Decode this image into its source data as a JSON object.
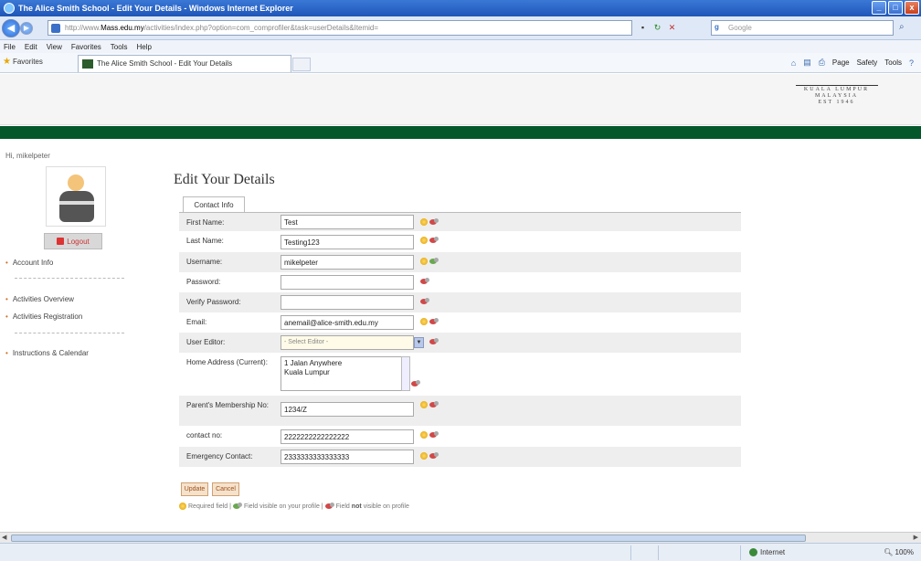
{
  "window": {
    "title": "The Alice Smith School - Edit Your Details - Windows Internet Explorer",
    "minimize": "_",
    "maximize": "□",
    "close": "x"
  },
  "address": {
    "host": "Mass.edu.my",
    "url_prefix": "http://www.",
    "url_rest": "/activities/index.php?option=com_comprofiler&task=userDetails&Itemid=",
    "search_placeholder": "Google"
  },
  "menu": [
    "File",
    "Edit",
    "View",
    "Favorites",
    "Tools",
    "Help"
  ],
  "favorites_label": "Favorites",
  "tab_title": "The Alice Smith School - Edit Your Details",
  "command_bar": [
    "Page",
    "Safety",
    "Tools"
  ],
  "logo": {
    "line1": "KUALA LUMPUR",
    "line2": "MALAYSIA",
    "line3": "EST 1946"
  },
  "sidebar": {
    "greeting": "Hi, mikelpeter",
    "logout": "Logout",
    "links": [
      "Account Info",
      "Activities Overview",
      "Activities Registration",
      "Instructions & Calendar"
    ]
  },
  "page": {
    "title": "Edit Your Details",
    "tab": "Contact Info"
  },
  "form": {
    "first_name": {
      "label": "First Name:",
      "value": "Test"
    },
    "last_name": {
      "label": "Last Name:",
      "value": "Testing123"
    },
    "username": {
      "label": "Username:",
      "value": "mikelpeter"
    },
    "password": {
      "label": "Password:",
      "value": ""
    },
    "verify_password": {
      "label": "Verify Password:",
      "value": ""
    },
    "email": {
      "label": "Email:",
      "value": "anemail@alice-smith.edu.my"
    },
    "user_editor": {
      "label": "User Editor:",
      "value": "- Select Editor -"
    },
    "home_address": {
      "label": "Home Address (Current):",
      "value": "1 Jalan Anywhere\nKuala Lumpur"
    },
    "membership_no": {
      "label": "Parent's Membership No:",
      "value": "1234/Z"
    },
    "contact_no": {
      "label": "contact no:",
      "value": "2222222222222222"
    },
    "emergency_contact": {
      "label": "Emergency Contact:",
      "value": "2333333333333333"
    }
  },
  "buttons": {
    "update": "Update",
    "cancel": "Cancel"
  },
  "legend": {
    "required": "Required field |",
    "visible": "Field visible on your profile |",
    "not_visible_prefix": "Field",
    "not_visible_bold": "not",
    "not_visible_suffix": "visible on profile"
  },
  "status": {
    "zone": "Internet",
    "zoom": "100%"
  }
}
